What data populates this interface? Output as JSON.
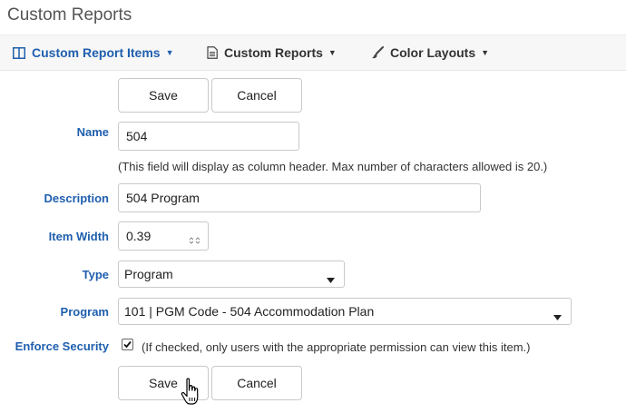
{
  "page": {
    "title": "Custom Reports"
  },
  "nav": {
    "items": [
      {
        "label": "Custom Report Items",
        "icon": "columns-icon",
        "active": true
      },
      {
        "label": "Custom Reports",
        "icon": "document-icon",
        "active": false
      },
      {
        "label": "Color Layouts",
        "icon": "paintbrush-icon",
        "active": false
      }
    ]
  },
  "toolbar_top": {
    "save_label": "Save",
    "cancel_label": "Cancel"
  },
  "form": {
    "name": {
      "label": "Name",
      "value": "504",
      "hint": "(This field will display as column header. Max number of characters allowed is 20.)"
    },
    "description": {
      "label": "Description",
      "value": "504 Program"
    },
    "item_width": {
      "label": "Item Width",
      "value": "0.39"
    },
    "type": {
      "label": "Type",
      "value": "Program"
    },
    "program": {
      "label": "Program",
      "value": "101 | PGM Code - 504 Accommodation Plan"
    },
    "enforce_security": {
      "label": "Enforce Security",
      "checked": true,
      "hint": "(If checked, only users with the appropriate permission can view this item.)"
    }
  },
  "toolbar_bottom": {
    "save_label": "Save",
    "cancel_label": "Cancel"
  },
  "colors": {
    "accent": "#1f5fae",
    "label": "#1f5fae",
    "border": "#c9c9c9"
  }
}
